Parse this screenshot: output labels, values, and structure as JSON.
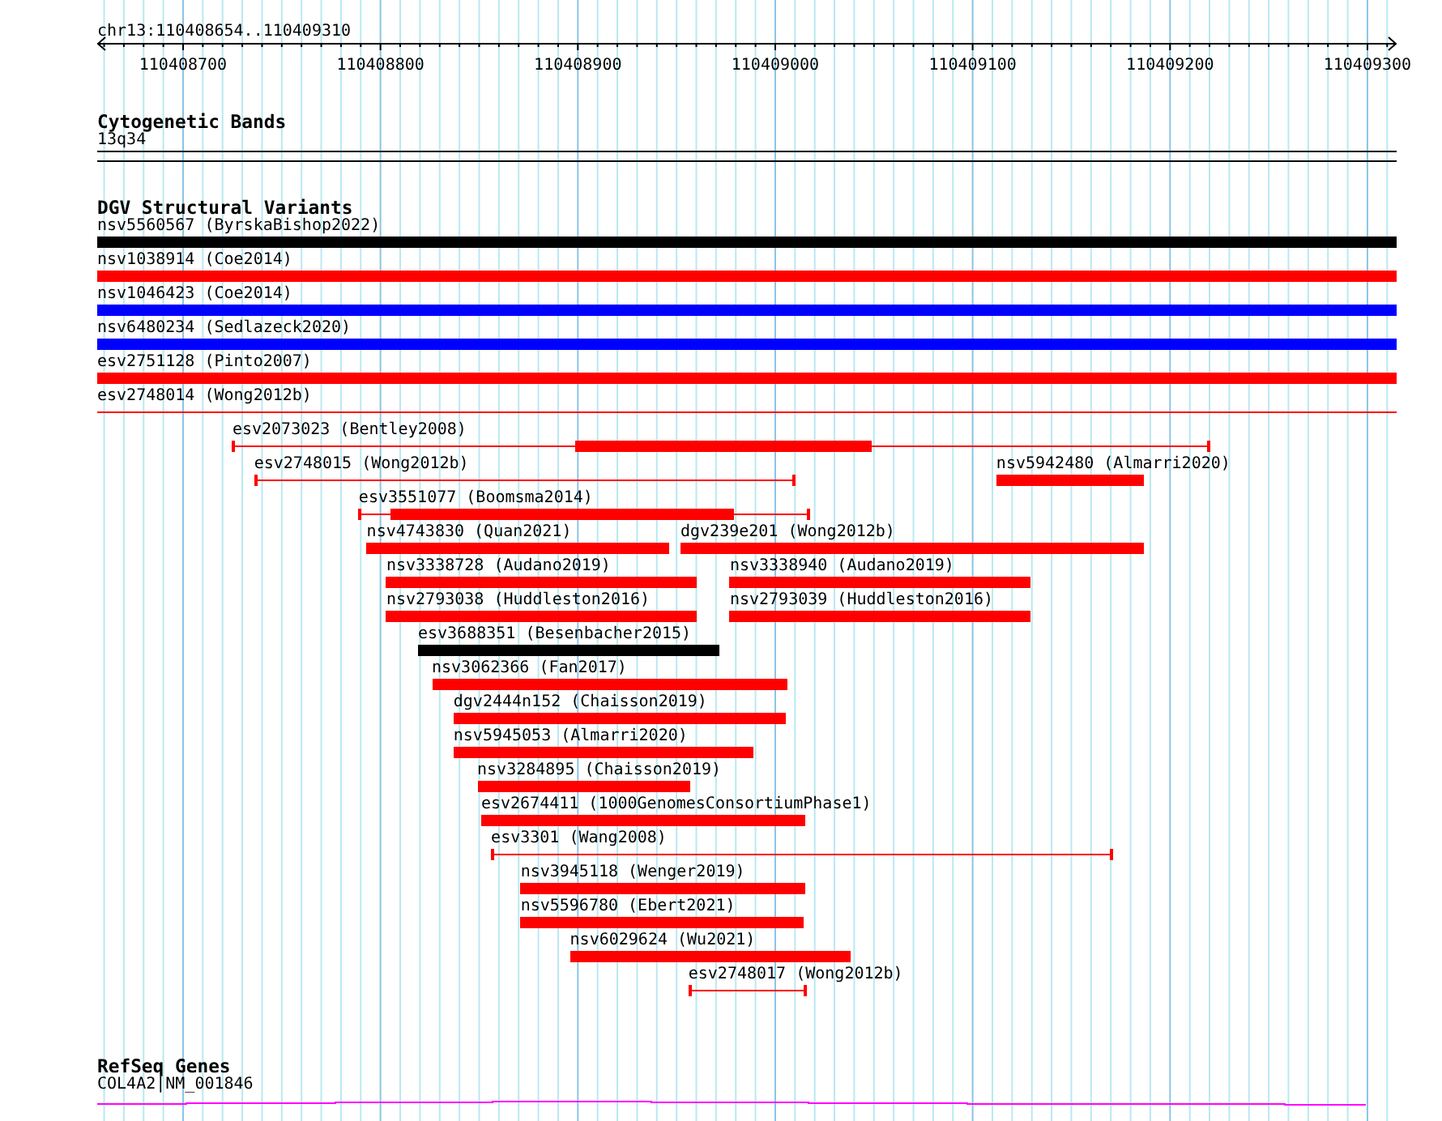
{
  "ruler": {
    "location": "chr13:110408654..110409310",
    "ticks": [
      "110408700",
      "110408800",
      "110408900",
      "110409000",
      "110409100",
      "110409200",
      "110409300"
    ]
  },
  "tracks": [
    {
      "kind": "cytoband",
      "title": "Cytogenetic Bands",
      "band": "13q34"
    },
    {
      "kind": "variants",
      "title": "DGV Structural Variants",
      "lanes": [
        {
          "features": [
            {
              "label": "nsv5560567 (ByrskaBishop2022)",
              "color": "#000000",
              "kind": "block"
            }
          ]
        },
        {
          "features": [
            {
              "label": "nsv1038914 (Coe2014)",
              "color": "#ff0000",
              "kind": "block"
            }
          ]
        },
        {
          "features": [
            {
              "label": "nsv1046423 (Coe2014)",
              "color": "#0000ff",
              "kind": "block"
            }
          ]
        },
        {
          "features": [
            {
              "label": "nsv6480234 (Sedlazeck2020)",
              "color": "#0000ff",
              "kind": "block"
            }
          ]
        },
        {
          "features": [
            {
              "label": "esv2751128 (Pinto2007)",
              "color": "#ff0000",
              "kind": "block"
            }
          ]
        },
        {
          "features": [
            {
              "label": "esv2748014 (Wong2012b)",
              "color": "#ff0000",
              "kind": "line"
            }
          ]
        },
        {
          "features": [
            {
              "label": "esv2073023 (Bentley2008)",
              "color": "#ff0000",
              "kind": "line_block"
            }
          ]
        },
        {
          "features": [
            {
              "label": "esv2748015 (Wong2012b)",
              "color": "#ff0000",
              "kind": "line"
            },
            {
              "label": "nsv5942480 (Almarri2020)",
              "color": "#ff0000",
              "kind": "block"
            }
          ]
        },
        {
          "features": [
            {
              "label": "esv3551077 (Boomsma2014)",
              "color": "#ff0000",
              "kind": "line_block"
            }
          ]
        },
        {
          "features": [
            {
              "label": "nsv4743830 (Quan2021)",
              "color": "#ff0000",
              "kind": "block"
            },
            {
              "label": "dgv239e201 (Wong2012b)",
              "color": "#ff0000",
              "kind": "block"
            }
          ]
        },
        {
          "features": [
            {
              "label": "nsv3338728 (Audano2019)",
              "color": "#ff0000",
              "kind": "block"
            },
            {
              "label": "nsv3338940 (Audano2019)",
              "color": "#ff0000",
              "kind": "block"
            }
          ]
        },
        {
          "features": [
            {
              "label": "nsv2793038 (Huddleston2016)",
              "color": "#ff0000",
              "kind": "block"
            },
            {
              "label": "nsv2793039 (Huddleston2016)",
              "color": "#ff0000",
              "kind": "block"
            }
          ]
        },
        {
          "features": [
            {
              "label": "esv3688351 (Besenbacher2015)",
              "color": "#000000",
              "kind": "block"
            }
          ]
        },
        {
          "features": [
            {
              "label": "nsv3062366 (Fan2017)",
              "color": "#ff0000",
              "kind": "block"
            }
          ]
        },
        {
          "features": [
            {
              "label": "dgv2444n152 (Chaisson2019)",
              "color": "#ff0000",
              "kind": "block"
            }
          ]
        },
        {
          "features": [
            {
              "label": "nsv5945053 (Almarri2020)",
              "color": "#ff0000",
              "kind": "block"
            }
          ]
        },
        {
          "features": [
            {
              "label": "nsv3284895 (Chaisson2019)",
              "color": "#ff0000",
              "kind": "block"
            }
          ]
        },
        {
          "features": [
            {
              "label": "esv2674411 (1000GenomesConsortiumPhase1)",
              "color": "#ff0000",
              "kind": "block"
            }
          ]
        },
        {
          "features": [
            {
              "label": "esv3301 (Wang2008)",
              "color": "#ff0000",
              "kind": "line"
            }
          ]
        },
        {
          "features": [
            {
              "label": "nsv3945118 (Wenger2019)",
              "color": "#ff0000",
              "kind": "block"
            }
          ]
        },
        {
          "features": [
            {
              "label": "nsv5596780 (Ebert2021)",
              "color": "#ff0000",
              "kind": "block"
            }
          ]
        },
        {
          "features": [
            {
              "label": "nsv6029624 (Wu2021)",
              "color": "#ff0000",
              "kind": "block"
            }
          ]
        },
        {
          "features": [
            {
              "label": "esv2748017 (Wong2012b)",
              "color": "#ff0000",
              "kind": "line"
            }
          ]
        }
      ]
    },
    {
      "kind": "genes",
      "title": "RefSeq Genes",
      "gene": "COL4A2|NM_001846"
    }
  ]
}
